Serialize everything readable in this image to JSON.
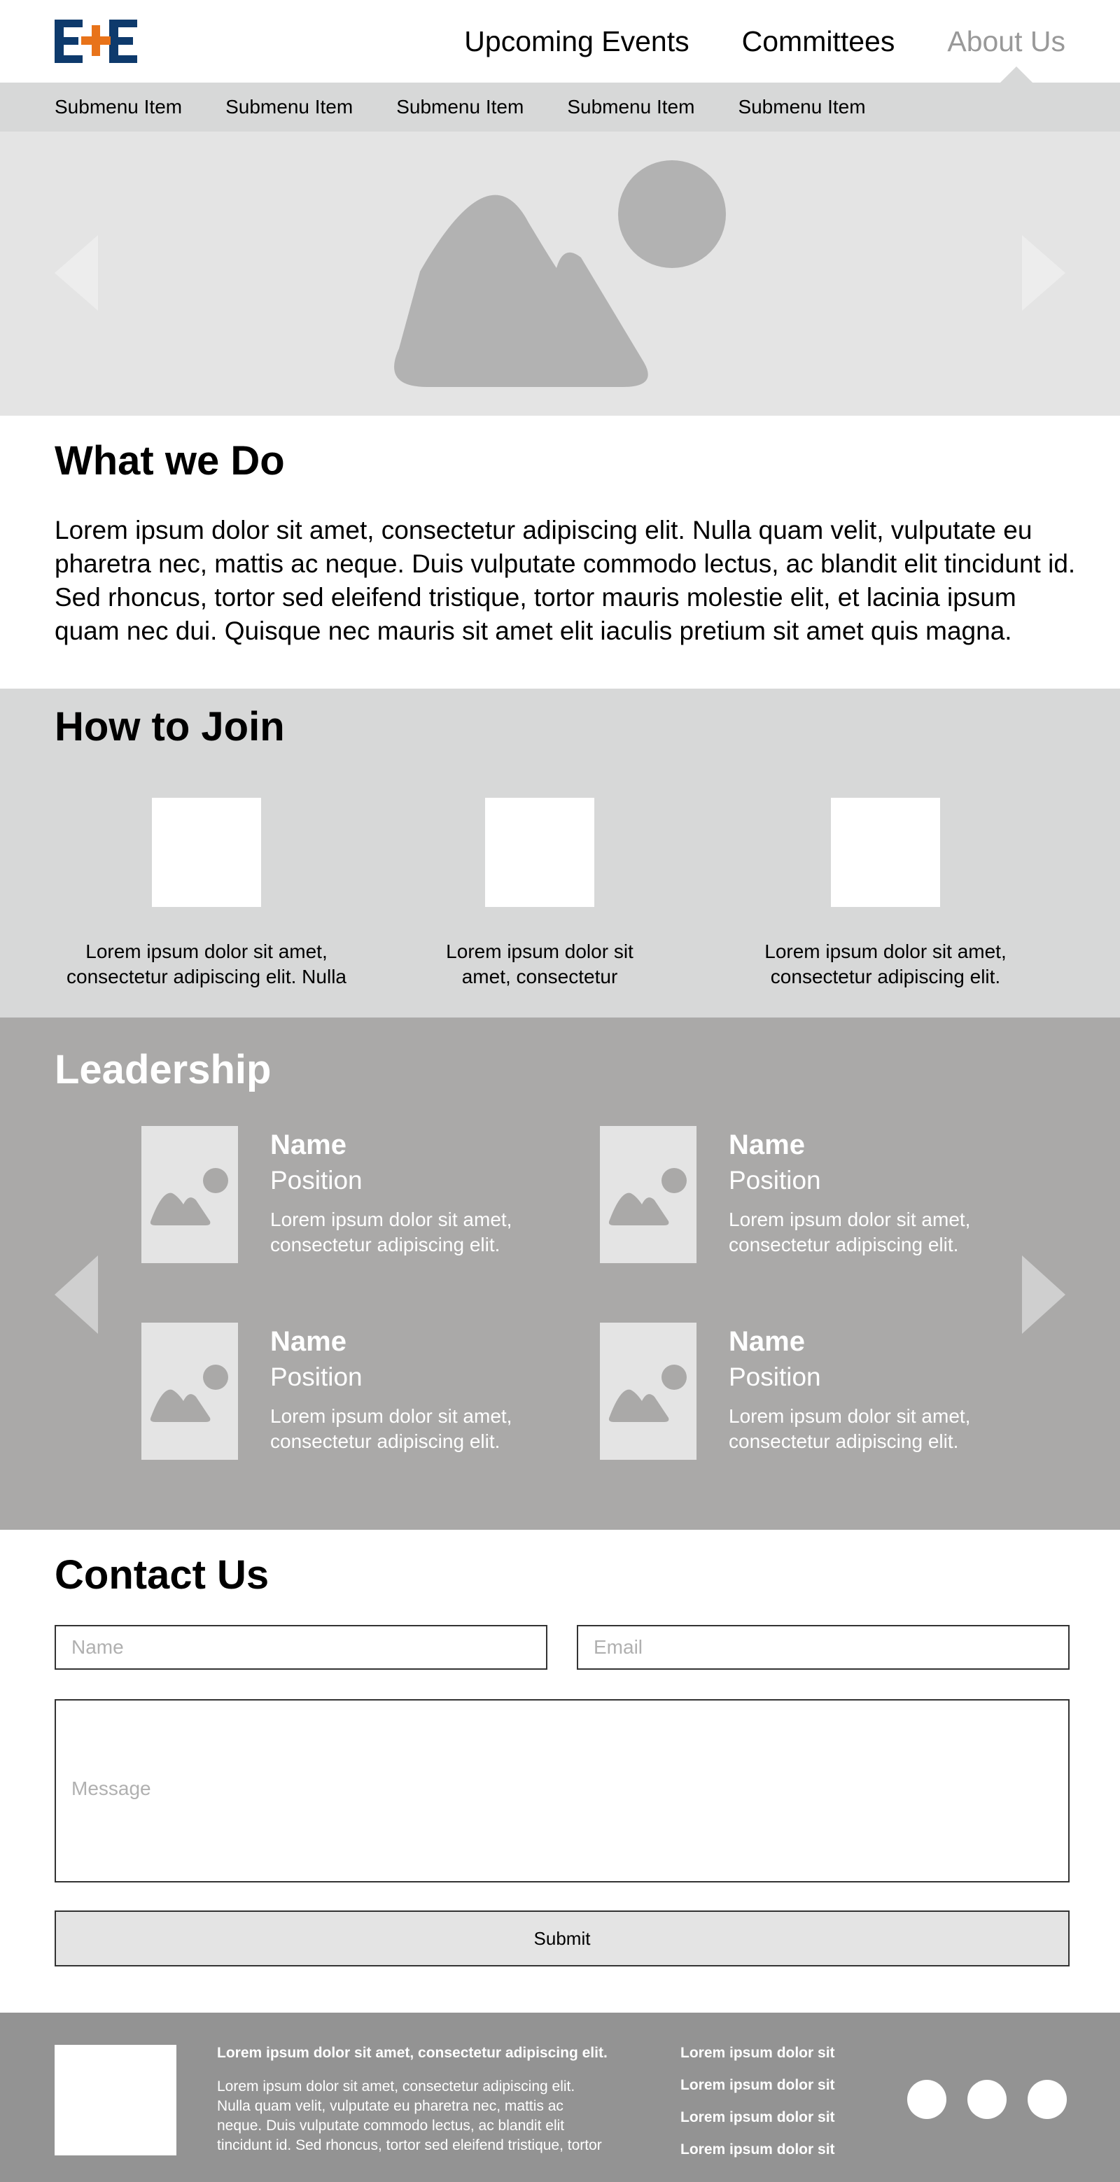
{
  "header": {
    "logo_text": "E+E",
    "nav": [
      {
        "label": "Upcoming Events",
        "active": false
      },
      {
        "label": "Committees",
        "active": false
      },
      {
        "label": "About Us",
        "active": true
      }
    ]
  },
  "submenu": {
    "items": [
      "Submenu Item",
      "Submenu Item",
      "Submenu Item",
      "Submenu Item",
      "Submenu Item"
    ]
  },
  "hero": {
    "icon": "image-placeholder-icon",
    "controls": [
      "carousel-prev-icon",
      "carousel-next-icon"
    ]
  },
  "what_we_do": {
    "title": "What we Do",
    "body": "Lorem ipsum dolor sit amet, consectetur adipiscing elit. Nulla quam velit, vulputate eu pharetra nec, mattis ac neque. Duis vulputate commodo lectus, ac blandit elit tincidunt id. Sed rhoncus, tortor sed eleifend tristique, tortor mauris molestie elit, et lacinia ipsum quam nec dui. Quisque nec mauris sit amet elit iaculis pretium sit amet quis magna."
  },
  "how_to_join": {
    "title": "How to Join",
    "items": [
      {
        "text": "Lorem ipsum dolor sit amet, consectetur adipiscing elit. Nulla"
      },
      {
        "text": "Lorem ipsum dolor sit amet, consectetur"
      },
      {
        "text": "Lorem ipsum dolor sit amet, consectetur adipiscing elit."
      }
    ]
  },
  "leadership": {
    "title": "Leadership",
    "people": [
      {
        "name": "Name",
        "position": "Position",
        "desc": "Lorem ipsum dolor sit amet, consectetur adipiscing elit."
      },
      {
        "name": "Name",
        "position": "Position",
        "desc": "Lorem ipsum dolor sit amet, consectetur adipiscing elit."
      },
      {
        "name": "Name",
        "position": "Position",
        "desc": "Lorem ipsum dolor sit amet, consectetur adipiscing elit."
      },
      {
        "name": "Name",
        "position": "Position",
        "desc": "Lorem ipsum dolor sit amet, consectetur adipiscing elit."
      }
    ]
  },
  "contact": {
    "title": "Contact Us",
    "name_placeholder": "Name",
    "email_placeholder": "Email",
    "message_placeholder": "Message",
    "submit_label": "Submit"
  },
  "footer": {
    "heading": "Lorem ipsum dolor sit amet, consectetur adipiscing elit.",
    "body": "Lorem ipsum dolor sit amet, consectetur adipiscing elit. Nulla quam velit, vulputate eu pharetra nec, mattis ac neque. Duis vulputate commodo lectus, ac blandit elit tincidunt id. Sed rhoncus, tortor sed eleifend tristique, tortor",
    "links": [
      "Lorem ipsum dolor sit",
      "Lorem ipsum dolor sit",
      "Lorem ipsum dolor sit",
      "Lorem ipsum dolor sit"
    ],
    "social_icons": [
      "social-icon",
      "social-icon",
      "social-icon"
    ]
  },
  "colors": {
    "logo_blue": "#0e3a6c",
    "logo_orange": "#e8731a",
    "submenu_bg": "#d7d8d8",
    "hero_bg": "#e4e4e4",
    "leadership_bg": "#aaa9a8",
    "footer_bg": "#939393",
    "nav_active": "#999999"
  }
}
